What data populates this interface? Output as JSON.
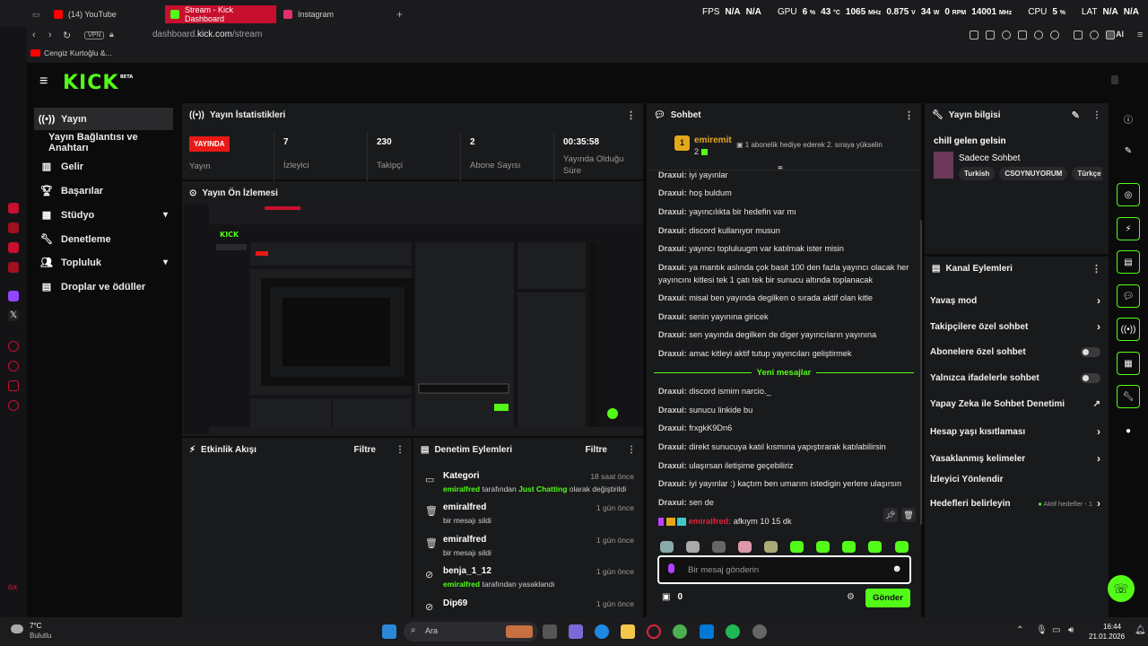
{
  "browser": {
    "tabs": [
      {
        "label": "(14) YouTube",
        "color": "#ff0000"
      },
      {
        "label": "Stream - Kick Dashboard",
        "color": "#53fc18"
      },
      {
        "label": "Instagram",
        "color": "#e1306c"
      }
    ],
    "new_tab": "+",
    "vpn": "VPN",
    "url_prefix": "dashboard.",
    "url_domain": "kick.com",
    "url_path": "/stream",
    "bookmark": "Cengiz Kurtoğlu &...",
    "ai_label": "AI"
  },
  "hud": {
    "fps_label": "FPS",
    "fps_val1": "N/A",
    "fps_val2": "N/A",
    "gpu_label": "GPU",
    "gpu_pct": "6",
    "gpu_temp": "43",
    "gpu_clock": "1065",
    "gpu_volt": "0.875",
    "gpu_watt": "34",
    "gpu_rpm": "0",
    "gpu_mem": "14001",
    "unit_pct": "%",
    "unit_c": "°C",
    "unit_mhz": "MHz",
    "unit_v": "V",
    "unit_w": "W",
    "unit_rpm": "RPM",
    "cpu_label": "CPU",
    "cpu_pct": "5",
    "lat_label": "LAT",
    "lat_val1": "N/A",
    "lat_val2": "N/A"
  },
  "brand": {
    "logo": "KICK",
    "beta": "BETA",
    "accent": "#53fc18"
  },
  "nav": {
    "items": [
      {
        "label": "Yayın",
        "icon": "broadcast-icon"
      },
      {
        "label": "Yayın Bağlantısı ve Anahtarı"
      },
      {
        "label": "Gelir",
        "icon": "chart-icon"
      },
      {
        "label": "Başarılar",
        "icon": "trophy-icon"
      },
      {
        "label": "Stüdyo",
        "icon": "studio-icon",
        "expand": "▾"
      },
      {
        "label": "Denetleme",
        "icon": "wrench-icon"
      },
      {
        "label": "Topluluk",
        "icon": "community-icon",
        "expand": "▾"
      },
      {
        "label": "Droplar ve ödüller",
        "icon": "drops-icon"
      }
    ]
  },
  "stats": {
    "title": "Yayın İstatistikleri",
    "live_badge": "YAYINDA",
    "live_label": "Yayın",
    "viewers_val": "7",
    "viewers_label": "İzleyici",
    "followers_val": "230",
    "followers_label": "Takipçi",
    "subs_val": "2",
    "subs_label": "Abone Sayısı",
    "uptime_val": "00:35:58",
    "uptime_label": "Yayında Olduğu Süre"
  },
  "preview": {
    "title": "Yayın Ön İzlemesi"
  },
  "activity": {
    "title": "Etkinlik Akışı",
    "filter": "Filtre"
  },
  "mod_actions": {
    "title": "Denetim Eylemleri",
    "filter": "Filtre",
    "rows": [
      {
        "title": "Kategori",
        "time": "18 saat önce",
        "user": "emiralfred",
        "mid": " tarafından ",
        "hl": "Just Chatting",
        "tail": " olarak değiştirildi"
      },
      {
        "title": "emiralfred",
        "time": "1 gün önce",
        "text": "bir mesajı sildi"
      },
      {
        "title": "emiralfred",
        "time": "1 gün önce",
        "text": "bir mesajı sildi"
      },
      {
        "title": "benja_1_12",
        "time": "1 gün önce",
        "user": "emiralfred",
        "tail": " tarafından yasaklandı"
      },
      {
        "title": "Dip69",
        "time": "1 gün önce"
      }
    ]
  },
  "chat": {
    "title": "Sohbet",
    "pinned_user": "emiremit",
    "pinned_rank": "1",
    "pinned_subs": "2",
    "pinned_text": "1 abonelik hediye ederek 2. sıraya yükselin",
    "author": "Draxui:",
    "messages_before": [
      "iyi yayınlar",
      "hoş buldum",
      "yayıncılıkta bir hedefin var mı",
      "discord kullanıyor musun",
      "yayıncı topluluugm var katılmak ister misin",
      "ya mantık aslında çok basit 100 den fazla yayıncı olacak her yayıncını kitlesi tek 1 çatı tek bir sunucu altında toplanacak",
      "misal ben yayında degilken o sırada aktif olan kitle",
      "senin yayınına giricek",
      "sen yayında degilken de diger yayıncıların yayınına",
      "amac kitleyi aktif tutup yayıncıları geliştirmek"
    ],
    "new_label": "Yeni mesajlar",
    "messages_after": [
      "discord ismim narcio._",
      "sunucu linkide bu",
      "frxgkK9Dn6",
      "direkt sunucuya katıl kısmına yapıştırarak katılabilirsin",
      "ulaşırsan iletişime geçebiliriz",
      "iyi yayınlar :) kaçtım ben umarım istedigin yerlere ulaşırsın",
      "sen de"
    ],
    "self_user": "emiralfred:",
    "self_text": "afkıym 10 15 dk",
    "input_placeholder": "Bir mesaj gönderin",
    "points": "0",
    "send": "Gönder"
  },
  "info": {
    "title": "Yayın bilgisi",
    "stream_title": "chill gelen gelsin",
    "chat_mode": "Sadece Sohbet",
    "tags": [
      "Turkish",
      "CSOYNUYORUM",
      "Türkçe"
    ]
  },
  "channel_actions": {
    "title": "Kanal Eylemleri",
    "rows": [
      {
        "label": "Yavaş mod",
        "type": "arrow"
      },
      {
        "label": "Takipçilere özel sohbet",
        "type": "arrow"
      },
      {
        "label": "Abonelere özel sohbet",
        "type": "toggle"
      },
      {
        "label": "Yalnızca ifadelerle sohbet",
        "type": "toggle"
      },
      {
        "label": "Yapay Zeka ile Sohbet Denetimi",
        "type": "ext"
      },
      {
        "label": "Hesap yaşı kısıtlaması",
        "type": "arrow"
      },
      {
        "label": "Yasaklanmış kelimeler",
        "type": "arrow"
      },
      {
        "label": "İzleyici Yönlendir",
        "type": "none"
      },
      {
        "label": "Hedefleri belirleyin",
        "type": "arrow",
        "extra": "Aktif hedefler - 1"
      }
    ]
  },
  "taskbar": {
    "temp": "7°C",
    "weather": "Bulutlu",
    "search": "Ara",
    "time": "16:44",
    "date": "21.01.2026"
  }
}
